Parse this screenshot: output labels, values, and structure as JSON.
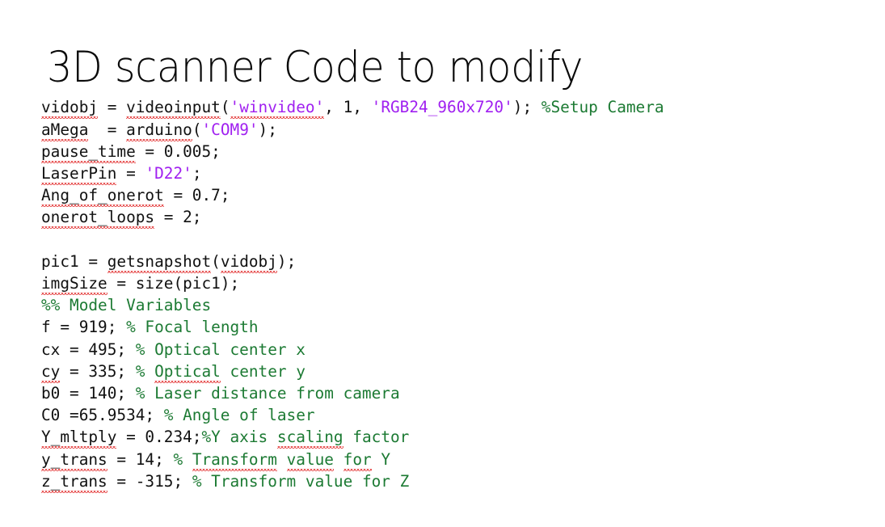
{
  "slide": {
    "title": "3D scanner Code to modify",
    "background_color": "#ffffff",
    "title_color": "#0a0a0a"
  },
  "colors": {
    "plain": "#111111",
    "string": "#a020f0",
    "comment": "#1c7a33",
    "spellcheck_underline": "#e02020"
  },
  "code": {
    "language": "MATLAB",
    "lines": [
      {
        "index": 1,
        "text": "vidobj = videoinput('winvideo', 1, 'RGB24_960x720'); %Setup Camera",
        "tokens": [
          {
            "t": "vidobj",
            "c": "plain",
            "spell": true
          },
          {
            "t": " = ",
            "c": "plain"
          },
          {
            "t": "videoinput",
            "c": "plain",
            "spell": true
          },
          {
            "t": "(",
            "c": "plain"
          },
          {
            "t": "'winvideo'",
            "c": "string",
            "spell": true
          },
          {
            "t": ", 1, ",
            "c": "plain"
          },
          {
            "t": "'RGB24_960x720'",
            "c": "string"
          },
          {
            "t": "); ",
            "c": "plain"
          },
          {
            "t": "%Setup Camera",
            "c": "comment"
          }
        ]
      },
      {
        "index": 2,
        "text": "aMega  = arduino('COM9');",
        "tokens": [
          {
            "t": "aMega",
            "c": "plain",
            "spell": true
          },
          {
            "t": "  = ",
            "c": "plain"
          },
          {
            "t": "arduino",
            "c": "plain",
            "spell": true
          },
          {
            "t": "(",
            "c": "plain"
          },
          {
            "t": "'COM9'",
            "c": "string"
          },
          {
            "t": ");",
            "c": "plain"
          }
        ]
      },
      {
        "index": 3,
        "text": "pause_time = 0.005;",
        "tokens": [
          {
            "t": "pause_time",
            "c": "plain",
            "spell": true
          },
          {
            "t": " = 0.005;",
            "c": "plain"
          }
        ]
      },
      {
        "index": 4,
        "text": "LaserPin = 'D22';",
        "tokens": [
          {
            "t": "LaserPin",
            "c": "plain",
            "spell": true
          },
          {
            "t": " = ",
            "c": "plain"
          },
          {
            "t": "'D22'",
            "c": "string"
          },
          {
            "t": ";",
            "c": "plain"
          }
        ]
      },
      {
        "index": 5,
        "text": "Ang_of_onerot = 0.7;",
        "tokens": [
          {
            "t": "Ang_of_onerot",
            "c": "plain",
            "spell": true
          },
          {
            "t": " = 0.7;",
            "c": "plain"
          }
        ]
      },
      {
        "index": 6,
        "text": "onerot_loops = 2;",
        "tokens": [
          {
            "t": "onerot_loops",
            "c": "plain",
            "spell": true
          },
          {
            "t": " = 2;",
            "c": "plain"
          }
        ]
      },
      {
        "index": 7,
        "text": "",
        "blank": true,
        "tokens": []
      },
      {
        "index": 8,
        "text": "pic1 = getsnapshot(vidobj);",
        "tokens": [
          {
            "t": "pic1 = ",
            "c": "plain"
          },
          {
            "t": "getsnapshot",
            "c": "plain",
            "spell": true
          },
          {
            "t": "(",
            "c": "plain"
          },
          {
            "t": "vidobj",
            "c": "plain",
            "spell": true
          },
          {
            "t": ");",
            "c": "plain"
          }
        ]
      },
      {
        "index": 9,
        "text": "imgSize = size(pic1);",
        "tokens": [
          {
            "t": "imgSize",
            "c": "plain",
            "spell": true
          },
          {
            "t": " = size(pic1);",
            "c": "plain"
          }
        ]
      },
      {
        "index": 10,
        "text": "%% Model Variables",
        "tokens": [
          {
            "t": "%% Model Variables",
            "c": "comment"
          }
        ]
      },
      {
        "index": 11,
        "text": "f = 919; % Focal length",
        "tokens": [
          {
            "t": "f = 919; ",
            "c": "plain"
          },
          {
            "t": "% Focal length",
            "c": "comment"
          }
        ]
      },
      {
        "index": 12,
        "text": "cx = 495; % Optical center x",
        "tokens": [
          {
            "t": "cx = 495; ",
            "c": "plain"
          },
          {
            "t": "% Optical center x",
            "c": "comment"
          }
        ]
      },
      {
        "index": 13,
        "text": "cy = 335; % Optical center y",
        "tokens": [
          {
            "t": "cy",
            "c": "plain",
            "spell": true
          },
          {
            "t": " = 335; ",
            "c": "plain"
          },
          {
            "t": "% ",
            "c": "comment"
          },
          {
            "t": "Optical",
            "c": "comment",
            "spell": true
          },
          {
            "t": " center y",
            "c": "comment"
          }
        ]
      },
      {
        "index": 14,
        "text": "b0 = 140; % Laser distance from camera",
        "tokens": [
          {
            "t": "b0 = 140; ",
            "c": "plain"
          },
          {
            "t": "% Laser distance from camera",
            "c": "comment"
          }
        ]
      },
      {
        "index": 15,
        "text": "C0 =65.9534; % Angle of laser",
        "tokens": [
          {
            "t": "C0 =65.9534; ",
            "c": "plain"
          },
          {
            "t": "% Angle of laser",
            "c": "comment"
          }
        ]
      },
      {
        "index": 16,
        "text": "Y_mltply = 0.234;%Y axis scaling factor",
        "tokens": [
          {
            "t": "Y_mltply",
            "c": "plain",
            "spell": true
          },
          {
            "t": " = 0.234;",
            "c": "plain"
          },
          {
            "t": "%Y axis ",
            "c": "comment"
          },
          {
            "t": "scaling",
            "c": "comment",
            "spell": true
          },
          {
            "t": " factor",
            "c": "comment"
          }
        ]
      },
      {
        "index": 17,
        "text": "y_trans = 14; % Transform value for Y",
        "tokens": [
          {
            "t": "y_trans",
            "c": "plain",
            "spell": true
          },
          {
            "t": " = 14; ",
            "c": "plain"
          },
          {
            "t": "% ",
            "c": "comment"
          },
          {
            "t": "Transform",
            "c": "comment",
            "spell": true
          },
          {
            "t": " ",
            "c": "comment"
          },
          {
            "t": "value",
            "c": "comment",
            "spell": true
          },
          {
            "t": " ",
            "c": "comment"
          },
          {
            "t": "for",
            "c": "comment",
            "spell": true
          },
          {
            "t": " Y",
            "c": "comment"
          }
        ]
      },
      {
        "index": 18,
        "text": "z_trans = -315; % Transform value for Z",
        "tokens": [
          {
            "t": "z_trans",
            "c": "plain",
            "spell": true
          },
          {
            "t": " = -315; ",
            "c": "plain"
          },
          {
            "t": "% Transform value for Z",
            "c": "comment"
          }
        ]
      }
    ]
  }
}
